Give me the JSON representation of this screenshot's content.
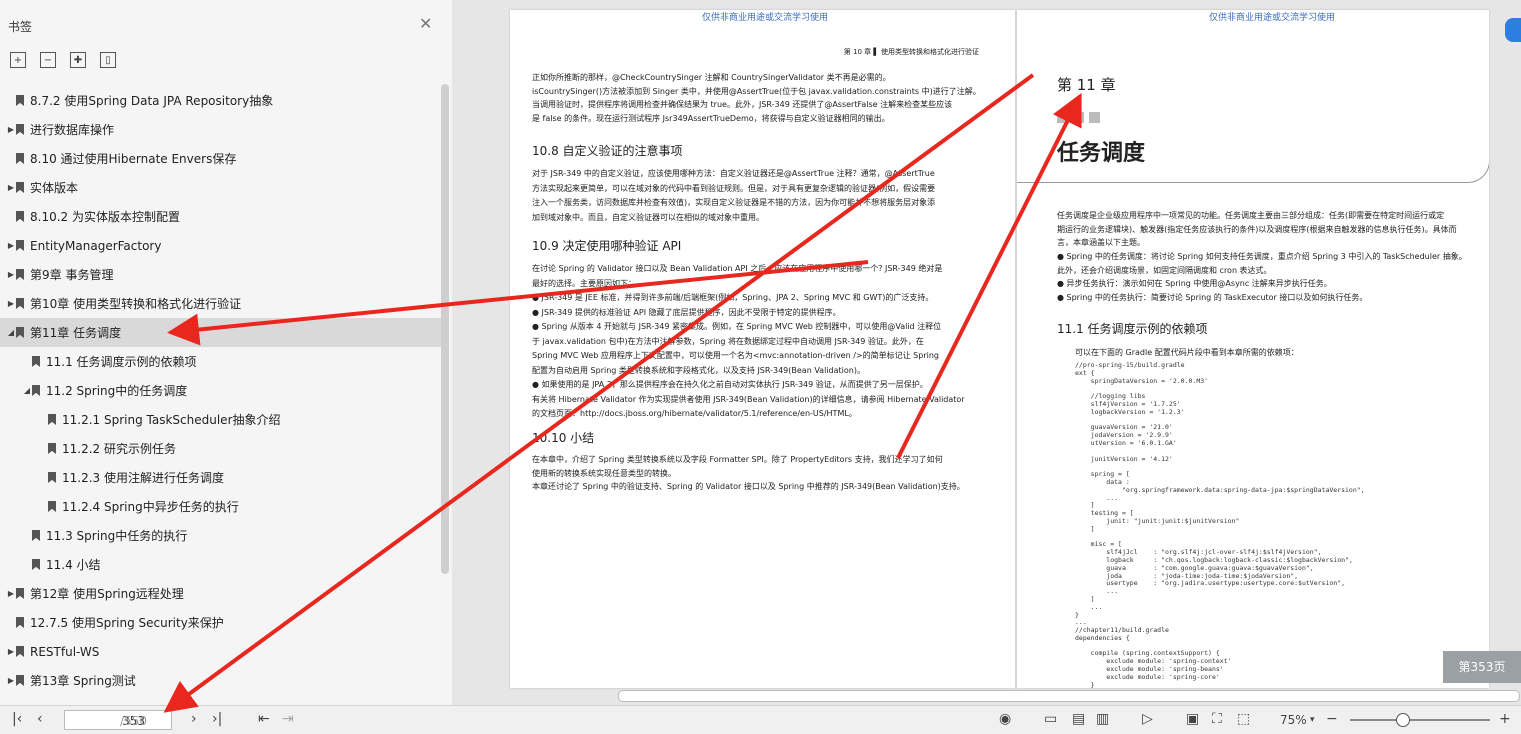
{
  "sidebar": {
    "title": "书签",
    "tree": [
      {
        "label": "8.7.2 使用Spring Data JPA Repository抽象",
        "level": 0,
        "expander": ""
      },
      {
        "label": "进行数据库操作",
        "level": 0,
        "expander": "▶"
      },
      {
        "label": "8.10 通过使用Hibernate Envers保存",
        "level": 0,
        "expander": ""
      },
      {
        "label": "实体版本",
        "level": 0,
        "expander": "▶"
      },
      {
        "label": "8.10.2 为实体版本控制配置",
        "level": 0,
        "expander": ""
      },
      {
        "label": "EntityManagerFactory",
        "level": 0,
        "expander": "▶"
      },
      {
        "label": "第9章 事务管理",
        "level": 0,
        "expander": "▶"
      },
      {
        "label": "第10章 使用类型转换和格式化进行验证",
        "level": 0,
        "expander": "▶"
      },
      {
        "label": "第11章 任务调度",
        "level": 0,
        "expander": "◢",
        "selected": true
      },
      {
        "label": "11.1 任务调度示例的依赖项",
        "level": 1,
        "expander": ""
      },
      {
        "label": "11.2 Spring中的任务调度",
        "level": 1,
        "expander": "◢"
      },
      {
        "label": "11.2.1 Spring TaskScheduler抽象介绍",
        "level": 2,
        "expander": ""
      },
      {
        "label": "11.2.2 研究示例任务",
        "level": 2,
        "expander": ""
      },
      {
        "label": "11.2.3 使用注解进行任务调度",
        "level": 2,
        "expander": ""
      },
      {
        "label": "11.2.4 Spring中异步任务的执行",
        "level": 2,
        "expander": ""
      },
      {
        "label": "11.3 Spring中任务的执行",
        "level": 1,
        "expander": ""
      },
      {
        "label": "11.4 小结",
        "level": 1,
        "expander": ""
      },
      {
        "label": "第12章 使用Spring远程处理",
        "level": 0,
        "expander": "▶"
      },
      {
        "label": "12.7.5 使用Spring Security来保护",
        "level": 0,
        "expander": ""
      },
      {
        "label": "RESTful-WS",
        "level": 0,
        "expander": "▶"
      },
      {
        "label": "第13章 Spring测试",
        "level": 0,
        "expander": "▶"
      }
    ]
  },
  "status": {
    "page_current": "353",
    "page_total": "/550",
    "zoom": "75%",
    "page_badge": "第353页"
  },
  "page_left": {
    "watermark": "仅供非商业用途或交流学习使用",
    "header": "第 10 章  ▌ 使用类型转换和格式化进行验证",
    "lines": [
      "正如你所推断的那样，@CheckCountrySinger 注解和 CountrySingerValidator 类不再是必需的。",
      "isCountrySinger()方法被添加到 Singer 类中，并使用@AssertTrue(位于包 javax.validation.constraints 中)进行了注解。",
      "当调用验证时，提供程序将调用检查并确保结果为 true。此外，JSR-349 还提供了@AssertFalse 注解来检查某些应该",
      "是 false 的条件。现在运行测试程序 Jsr349AssertTrueDemo，将获得与自定义验证器相同的输出。"
    ],
    "h108": "10.8   自定义验证的注意事项",
    "lines2": [
      "对于 JSR-349 中的自定义验证，应该使用哪种方法：自定义验证器还是@AssertTrue 注释？通常，@AssertTrue",
      "方法实现起来更简单，可以在域对象的代码中看到验证规则。但是，对于具有更复杂逻辑的验证器(例如，假设需要",
      "注入一个服务类，访问数据库并检查有效值)，实现自定义验证器是不错的方法，因为你可能并不想将服务层对象添",
      "加到域对象中。而且，自定义验证器可以在相似的域对象中重用。"
    ],
    "h109": "10.9   决定使用哪种验证 API",
    "lines3": [
      "在讨论 Spring 的 Validator 接口以及 Bean Validation API 之后，应该在应用程序中使用哪一个? JSR-349 绝对是",
      "最好的选择。主要原因如下：",
      "●  JSR-349 是 JEE 标准，并得到许多前端/后端框架(例如，Spring、JPA 2、Spring MVC 和 GWT)的广泛支持。",
      "●  JSR-349 提供的标准验证 API 隐藏了底层提供程序，因此不受限于特定的提供程序。",
      "●  Spring 从版本 4 开始就与 JSR-349 紧密集成。例如，在 Spring MVC Web 控制器中，可以使用@Valid 注释位",
      "    于 javax.validation 包中)在方法中注解参数，Spring 将在数据绑定过程中自动调用 JSR-349 验证。此外，在",
      "    Spring MVC Web 应用程序上下文配置中，可以使用一个名为<mvc:annotation-driven />的简单标记让 Spring",
      "    配置为自动启用 Spring 类型转换系统和字段格式化，以及支持 JSR-349(Bean Validation)。",
      "●  如果使用的是 JPA 2，那么提供程序会在持久化之前自动对实体执行 JSR-349 验证，从而提供了另一层保护。",
      "有关将 Hibernate Validator 作为实现提供者使用 JSR-349(Bean Validation)的详细信息，请参阅 Hibernate Validator",
      "的文档页面：http://docs.jboss.org/hibernate/validator/5.1/reference/en-US/HTML。"
    ],
    "h1010": "10.10   小结",
    "lines4": [
      "在本章中，介绍了 Spring 类型转换系统以及字段 Formatter SPI。除了 PropertyEditors 支持，我们还学习了如何",
      "使用新的转换系统实现任意类型的转换。",
      "本章还讨论了 Spring 中的验证支持、Spring 的 Validator 接口以及 Spring 中推荐的 JSR-349(Bean Validation)支持。"
    ]
  },
  "page_right": {
    "watermark": "仅供非商业用途或交流学习使用",
    "chapter_num": "第 11 章",
    "chapter_title": "任务调度",
    "intro": [
      "任务调度是企业级应用程序中一项常见的功能。任务调度主要由三部分组成：任务(即需要在特定时间运行或定",
      "期运行的业务逻辑块)、触发器(指定任务应该执行的条件)以及调度程序(根据来自触发器的信息执行任务)。具体而",
      "言，本章涵盖以下主题。"
    ],
    "bullets": [
      "●  Spring 中的任务调度：将讨论 Spring 如何支持任务调度，重点介绍 Spring 3 中引入的 TaskScheduler 抽象。",
      "    此外，还会介绍调度场景，如固定间隔调度和 cron 表达式。",
      "●  异步任务执行：演示如何在 Spring 中使用@Async 注解来异步执行任务。",
      "●  Spring 中的任务执行：简要讨论 Spring 的 TaskExecutor 接口以及如何执行任务。"
    ],
    "h111": "11.1   任务调度示例的依赖项",
    "dep_intro": "可以在下面的 Gradle 配置代码片段中看到本章所需的依赖项：",
    "code": "//pro-spring-15/build.gradle\next {\n    springDataVersion = '2.0.0.M3'\n\n    //logging libs\n    slf4jVersion = '1.7.25'\n    logbackVersion = '1.2.3'\n\n    guavaVersion = '21.0'\n    jodaVersion = '2.9.9'\n    utVersion = '6.0.1.GA'\n\n    junitVersion = '4.12'\n\n    spring = [\n        data :\n            \"org.springframework.data:spring-data-jpa:$springDataVersion\",\n        ...\n    ]\n    testing = [\n        junit: \"junit:junit:$junitVersion\"\n    ]\n\n    misc = [\n        slf4jJcl    : \"org.slf4j:jcl-over-slf4j:$slf4jVersion\",\n        logback     : \"ch.qos.logback:logback-classic:$logbackVersion\",\n        guava       : \"com.google.guava:guava:$guavaVersion\",\n        joda        : \"joda-time:joda-time:$jodaVersion\",\n        usertype    : \"org.jadira.usertype:usertype.core:$utVersion\",\n        ...\n    ]\n    ...\n}\n...\n//chapter11/build.gradle\ndependencies {\n\n    compile (spring.contextSupport) {\n        exclude module: 'spring-context'\n        exclude module: 'spring-beans'\n        exclude module: 'spring-core'\n    }"
  }
}
